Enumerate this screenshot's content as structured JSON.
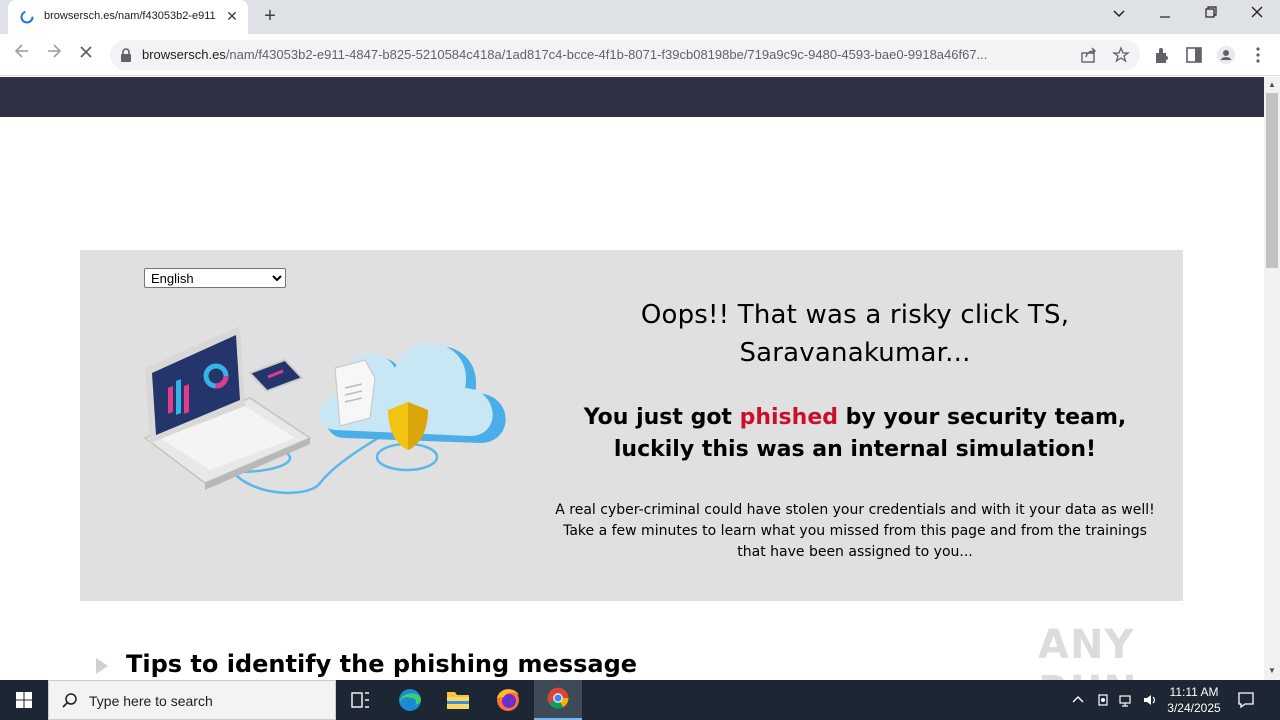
{
  "browser": {
    "tab_title": "browsersch.es/nam/f43053b2-e911",
    "tab_close": "✕",
    "new_tab": "+",
    "url_host": "browsersch.es",
    "url_path": "/nam/f43053b2-e911-4847-b825-5210584c418a/1ad817c4-bcce-4f1b-8071-f39cb08198be/719a9c9c-9480-4593-bae0-9918a46f67..."
  },
  "page": {
    "language_options": [
      "English"
    ],
    "language_selected": "English",
    "oops_line": "Oops!! That was a risky click TS, Saravanakumar...",
    "phished_prefix": "You just got ",
    "phished_word": "phished",
    "phished_suffix": " by your security team, luckily this was an internal simulation!",
    "explanation": "A real cyber-criminal could have stolen your credentials and with it your data as well! Take a few minutes to learn what you missed from this page and from the trainings that have been assigned to you...",
    "tips_heading": "Tips to identify the phishing message",
    "watermark": "ANY RUN"
  },
  "taskbar": {
    "search_placeholder": "Type here to search",
    "time": "11:11 AM",
    "date": "3/24/2025"
  },
  "colors": {
    "header_dark": "#2f3044",
    "hero_bg": "#e0e0e0",
    "phished_red": "#c8102e",
    "taskbar": "#1c2733"
  }
}
